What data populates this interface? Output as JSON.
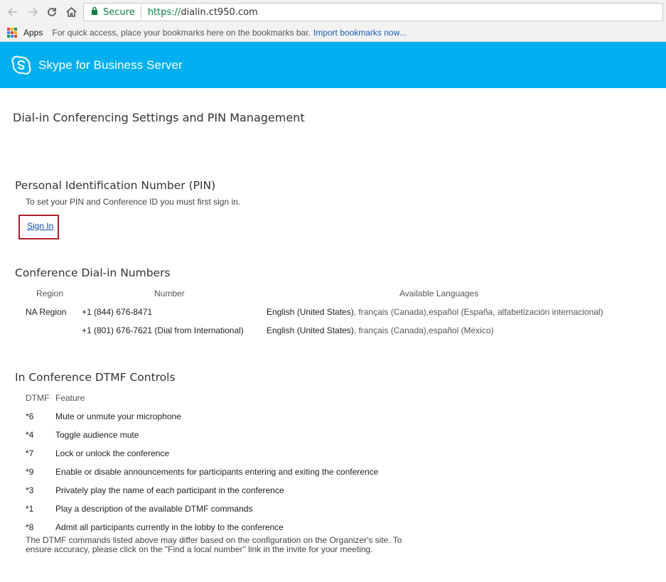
{
  "browser": {
    "secure_label": "Secure",
    "url_protocol": "https://",
    "url_host": "dialin.ct950.com",
    "bookmarks": {
      "apps_label": "Apps",
      "hint": "For quick access, place your bookmarks here on the bookmarks bar.",
      "import_link": "Import bookmarks now..."
    }
  },
  "banner": {
    "title": "Skype for Business Server",
    "color": "#00aff0"
  },
  "page": {
    "title": "Dial-in Conferencing Settings and PIN Management"
  },
  "pin": {
    "heading": "Personal Identification Number (PIN)",
    "instruction": "To set your PIN and Conference ID you must first sign in.",
    "signin_label": "Sign In"
  },
  "dialin": {
    "heading": "Conference Dial-in Numbers",
    "columns": {
      "region": "Region",
      "number": "Number",
      "languages": "Available Languages"
    },
    "rows": [
      {
        "region": "NA Region",
        "number": "+1 (844) 676-8471",
        "lang_primary": "English (United States)",
        "lang_others": ", français (Canada),español (España, alfabetización internacional)"
      },
      {
        "region": "",
        "number": "+1 (801) 676-7621 (Dial from International)",
        "lang_primary": "English (United States)",
        "lang_others": ", français (Canada),español (México)"
      }
    ]
  },
  "dtmf": {
    "heading": "In Conference DTMF Controls",
    "columns": {
      "code": "DTMF",
      "feature": "Feature"
    },
    "rows": [
      {
        "code": "*6",
        "feature": "Mute or unmute your microphone"
      },
      {
        "code": "*4",
        "feature": "Toggle audience mute"
      },
      {
        "code": "*7",
        "feature": "Lock or unlock the conference"
      },
      {
        "code": "*9",
        "feature": "Enable or disable announcements for participants entering and exiting the conference"
      },
      {
        "code": "*3",
        "feature": "Privately play the name of each participant in the conference"
      },
      {
        "code": "*1",
        "feature": "Play a description of the available DTMF commands"
      },
      {
        "code": "*8",
        "feature": "Admit all participants currently in the lobby to the conference"
      }
    ],
    "note": "The DTMF commands listed above may differ based on the configuration on the Organizer's site. To ensure accuracy, please click on the \"Find a local number\" link in the invite for your meeting."
  }
}
